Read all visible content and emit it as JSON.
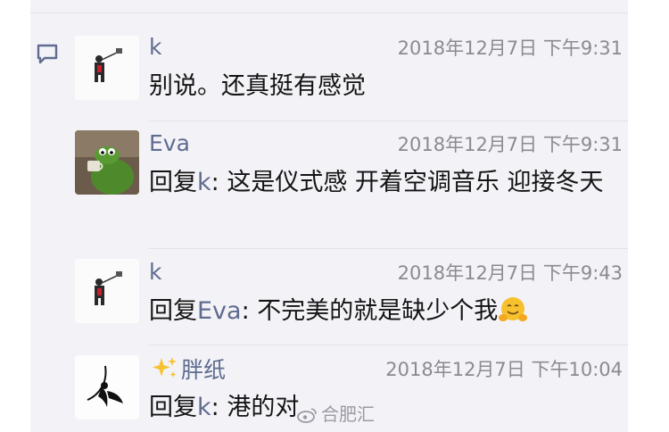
{
  "comments": [
    {
      "author": "k",
      "avatar": "man-with-sign-avatar",
      "timestamp": "2018年12月7日 下午9:31",
      "text": "别说。还真挺有感觉"
    },
    {
      "author": "Eva",
      "avatar": "kermit-sipping-tea-avatar",
      "timestamp": "2018年12月7日 下午9:31",
      "reply_prefix": "回复",
      "reply_to": "k",
      "reply_sep": ": ",
      "text": "这是仪式感 开着空调音乐 迎接冬天"
    },
    {
      "author": "k",
      "avatar": "man-with-sign-avatar",
      "timestamp": "2018年12月7日 下午9:43",
      "reply_prefix": "回复",
      "reply_to": "Eva",
      "reply_sep": ": ",
      "text": "不完美的就是缺少个我",
      "emoji": "hugging-face-emoji"
    },
    {
      "author": "胖纸",
      "author_prefix_icon": "sparkles-icon",
      "avatar": "ink-bird-avatar",
      "timestamp": "2018年12月7日 下午10:04",
      "reply_prefix": "回复",
      "reply_to": "k",
      "reply_sep": ": ",
      "text": "港的对"
    }
  ],
  "watermark": {
    "text": "合肥汇",
    "icon": "weibo-logo-icon"
  },
  "colors": {
    "name": "#5f6c90",
    "timestamp": "#8a8a90",
    "panel_bg": "#f3f3f7",
    "text": "#141414"
  }
}
